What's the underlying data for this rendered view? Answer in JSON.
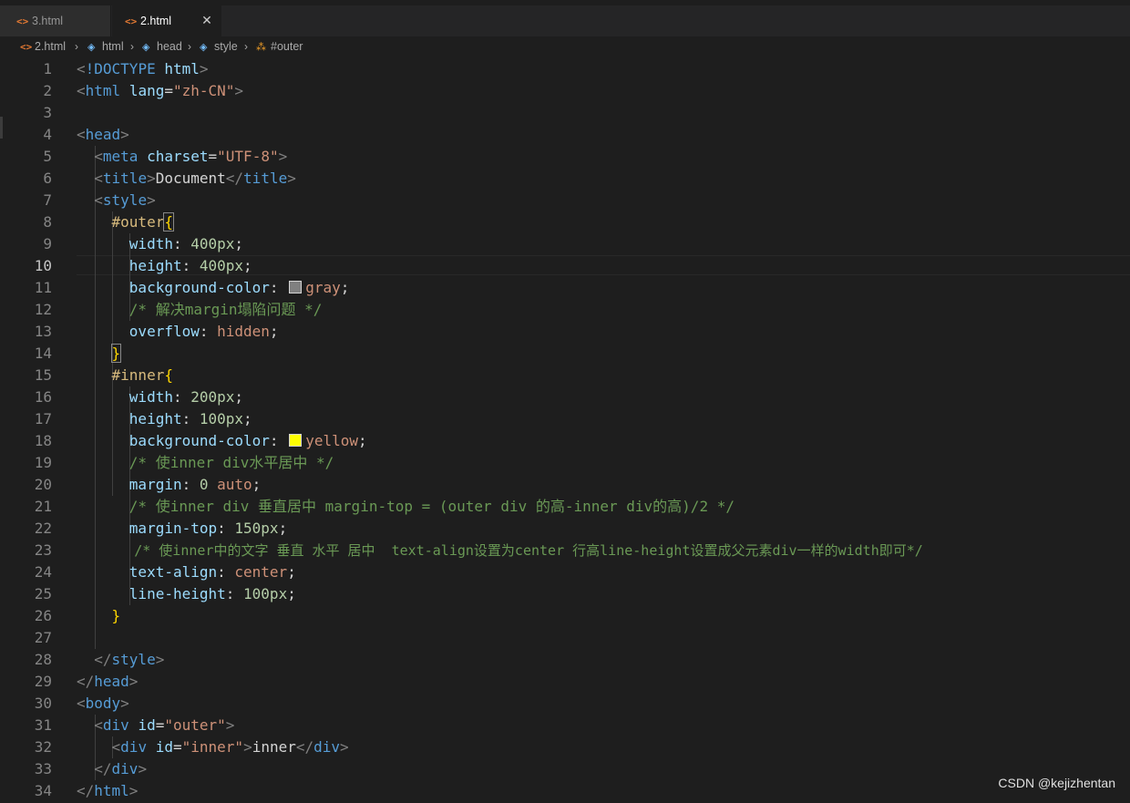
{
  "tabs": [
    {
      "label": "3.html",
      "icon": "html-file-icon"
    },
    {
      "label": "2.html",
      "icon": "html-file-icon",
      "active": true
    }
  ],
  "close_glyph": "✕",
  "breadcrumbs": [
    "2.html",
    "html",
    "head",
    "style",
    "#outer"
  ],
  "active_line": 10,
  "line_numbers": [
    "1",
    "2",
    "3",
    "4",
    "5",
    "6",
    "7",
    "8",
    "9",
    "10",
    "11",
    "12",
    "13",
    "14",
    "15",
    "16",
    "17",
    "18",
    "19",
    "20",
    "21",
    "22",
    "23",
    "24",
    "25",
    "26",
    "27",
    "28",
    "29",
    "30",
    "31",
    "32",
    "33",
    "34"
  ],
  "code": {
    "l1_doctype": "!DOCTYPE",
    "l1_html": "html",
    "l2_tag": "html",
    "l2_attr": "lang",
    "l2_val": "\"zh-CN\"",
    "l4_tag": "head",
    "l5_tag": "meta",
    "l5_attr": "charset",
    "l5_val": "\"UTF-8\"",
    "l6_tag": "title",
    "l6_text": "Document",
    "l7_tag": "style",
    "l8_sel": "#outer",
    "l9_prop": "width",
    "l9_val": "400px",
    "l10_prop": "height",
    "l10_val": "400px",
    "l11_prop": "background-color",
    "l11_val": "gray",
    "l11_swatch": "#808080",
    "l12_comment": "/* 解决margin塌陷问题 */",
    "l13_prop": "overflow",
    "l13_val": "hidden",
    "l15_sel": "#inner",
    "l16_prop": "width",
    "l16_val": "200px",
    "l17_prop": "height",
    "l17_val": "100px",
    "l18_prop": "background-color",
    "l18_val": "yellow",
    "l18_swatch": "#ffff00",
    "l19_comment": "/* 使inner div水平居中 */",
    "l20_prop": "margin",
    "l20_val1": "0",
    "l20_val2": "auto",
    "l21_comment": "/* 使inner div 垂直居中 margin-top = (outer div 的高-inner div的高)/2 */",
    "l22_prop": "margin-top",
    "l22_val": "150px",
    "l23_comment": "/* 使inner中的文字 垂直 水平 居中  text-align设置为center 行高line-height设置成父元素div一样的width即可*/",
    "l24_prop": "text-align",
    "l24_val": "center",
    "l25_prop": "line-height",
    "l25_val": "100px",
    "l28_tag": "style",
    "l29_tag": "head",
    "l30_tag": "body",
    "l31_tag": "div",
    "l31_attr": "id",
    "l31_val": "\"outer\"",
    "l32_tag": "div",
    "l32_attr": "id",
    "l32_val": "\"inner\"",
    "l32_text": "inner",
    "l32_close": "div",
    "l33_tag": "div",
    "l34_tag": "html"
  },
  "watermark": "CSDN @kejizhentan",
  "colors": {
    "background": "#1e1e1e",
    "tag": "#569cd6",
    "attribute": "#9cdcfe",
    "string": "#ce9178",
    "number": "#b5cea8",
    "comment": "#6a9955",
    "selector": "#d7ba7d",
    "bracket": "#ffd700"
  }
}
